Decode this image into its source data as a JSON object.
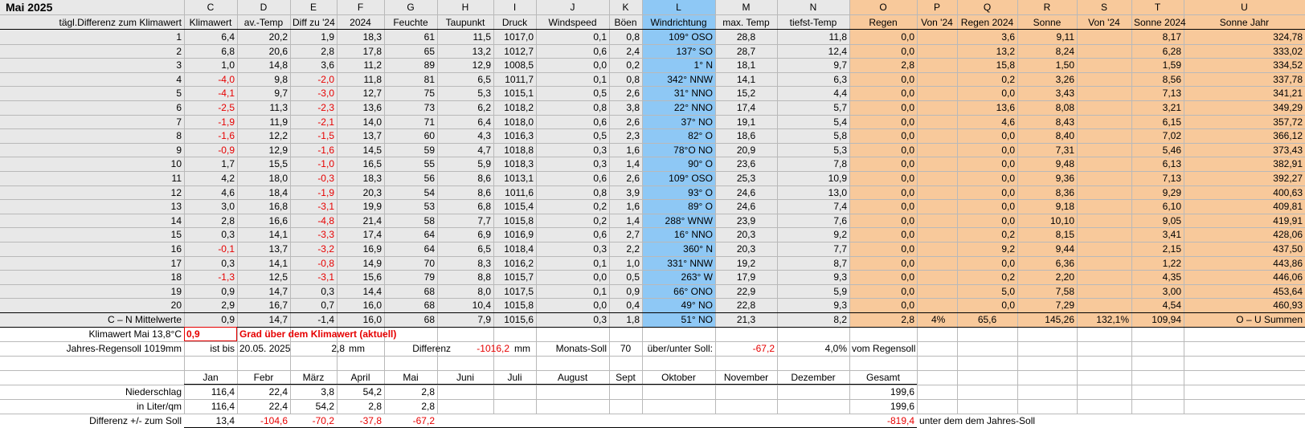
{
  "title": "Mai 2025",
  "subtitle": "tägl.Differenz zum Klimawert",
  "letters": [
    "C",
    "D",
    "E",
    "F",
    "G",
    "H",
    "I",
    "J",
    "K",
    "L",
    "M",
    "N",
    "O",
    "P",
    "Q",
    "R",
    "S",
    "T",
    "U"
  ],
  "headers": [
    "Klimawert",
    "av.-Temp",
    "Diff zu '24",
    "2024",
    "Feuchte",
    "Taupunkt",
    "Druck",
    "Windspeed",
    "Böen",
    "Windrichtung",
    "max. Temp",
    "tiefst-Temp",
    "Regen",
    "Von '24",
    "Regen 2024",
    "Sonne",
    "Von '24",
    "Sonne 2024",
    "Sonne Jahr"
  ],
  "rows": [
    [
      "1",
      "6,4",
      "20,2",
      "1,9",
      "18,3",
      "61",
      "11,5",
      "1017,0",
      "0,1",
      "0,8",
      "109° OSO",
      "28,8",
      "11,8",
      "0,0",
      "",
      "3,6",
      "9,11",
      "",
      "8,17",
      "324,78"
    ],
    [
      "2",
      "6,8",
      "20,6",
      "2,8",
      "17,8",
      "65",
      "13,2",
      "1012,7",
      "0,6",
      "2,4",
      "137° SO",
      "28,7",
      "12,4",
      "0,0",
      "",
      "13,2",
      "8,24",
      "",
      "6,28",
      "333,02"
    ],
    [
      "3",
      "1,0",
      "14,8",
      "3,6",
      "11,2",
      "89",
      "12,9",
      "1008,5",
      "0,0",
      "0,2",
      "1° N",
      "18,1",
      "9,7",
      "2,8",
      "",
      "15,8",
      "1,50",
      "",
      "1,59",
      "334,52"
    ],
    [
      "4",
      "-4,0",
      "9,8",
      "-2,0",
      "11,8",
      "81",
      "6,5",
      "1011,7",
      "0,1",
      "0,8",
      "342° NNW",
      "14,1",
      "6,3",
      "0,0",
      "",
      "0,2",
      "3,26",
      "",
      "8,56",
      "337,78"
    ],
    [
      "5",
      "-4,1",
      "9,7",
      "-3,0",
      "12,7",
      "75",
      "5,3",
      "1015,1",
      "0,5",
      "2,6",
      "31° NNO",
      "15,2",
      "4,4",
      "0,0",
      "",
      "0,0",
      "3,43",
      "",
      "7,13",
      "341,21"
    ],
    [
      "6",
      "-2,5",
      "11,3",
      "-2,3",
      "13,6",
      "73",
      "6,2",
      "1018,2",
      "0,8",
      "3,8",
      "22° NNO",
      "17,4",
      "5,7",
      "0,0",
      "",
      "13,6",
      "8,08",
      "",
      "3,21",
      "349,29"
    ],
    [
      "7",
      "-1,9",
      "11,9",
      "-2,1",
      "14,0",
      "71",
      "6,4",
      "1018,0",
      "0,6",
      "2,6",
      "37° NO",
      "19,1",
      "5,4",
      "0,0",
      "",
      "4,6",
      "8,43",
      "",
      "6,15",
      "357,72"
    ],
    [
      "8",
      "-1,6",
      "12,2",
      "-1,5",
      "13,7",
      "60",
      "4,3",
      "1016,3",
      "0,5",
      "2,3",
      "82° O",
      "18,6",
      "5,8",
      "0,0",
      "",
      "0,0",
      "8,40",
      "",
      "7,02",
      "366,12"
    ],
    [
      "9",
      "-0,9",
      "12,9",
      "-1,6",
      "14,5",
      "59",
      "4,7",
      "1018,8",
      "0,3",
      "1,6",
      "78°O NO",
      "20,9",
      "5,3",
      "0,0",
      "",
      "0,0",
      "7,31",
      "",
      "5,46",
      "373,43"
    ],
    [
      "10",
      "1,7",
      "15,5",
      "-1,0",
      "16,5",
      "55",
      "5,9",
      "1018,3",
      "0,3",
      "1,4",
      "90° O",
      "23,6",
      "7,8",
      "0,0",
      "",
      "0,0",
      "9,48",
      "",
      "6,13",
      "382,91"
    ],
    [
      "11",
      "4,2",
      "18,0",
      "-0,3",
      "18,3",
      "56",
      "8,6",
      "1013,1",
      "0,6",
      "2,6",
      "109° OSO",
      "25,3",
      "10,9",
      "0,0",
      "",
      "0,0",
      "9,36",
      "",
      "7,13",
      "392,27"
    ],
    [
      "12",
      "4,6",
      "18,4",
      "-1,9",
      "20,3",
      "54",
      "8,6",
      "1011,6",
      "0,8",
      "3,9",
      "93° O",
      "24,6",
      "13,0",
      "0,0",
      "",
      "0,0",
      "8,36",
      "",
      "9,29",
      "400,63"
    ],
    [
      "13",
      "3,0",
      "16,8",
      "-3,1",
      "19,9",
      "53",
      "6,8",
      "1015,4",
      "0,2",
      "1,6",
      "89° O",
      "24,6",
      "7,4",
      "0,0",
      "",
      "0,0",
      "9,18",
      "",
      "6,10",
      "409,81"
    ],
    [
      "14",
      "2,8",
      "16,6",
      "-4,8",
      "21,4",
      "58",
      "7,7",
      "1015,8",
      "0,2",
      "1,4",
      "288° WNW",
      "23,9",
      "7,6",
      "0,0",
      "",
      "0,0",
      "10,10",
      "",
      "9,05",
      "419,91"
    ],
    [
      "15",
      "0,3",
      "14,1",
      "-3,3",
      "17,4",
      "64",
      "6,9",
      "1016,9",
      "0,6",
      "2,7",
      "16° NNO",
      "20,3",
      "9,2",
      "0,0",
      "",
      "0,2",
      "8,15",
      "",
      "3,41",
      "428,06"
    ],
    [
      "16",
      "-0,1",
      "13,7",
      "-3,2",
      "16,9",
      "64",
      "6,5",
      "1018,4",
      "0,3",
      "2,2",
      "360° N",
      "20,3",
      "7,7",
      "0,0",
      "",
      "9,2",
      "9,44",
      "",
      "2,15",
      "437,50"
    ],
    [
      "17",
      "0,3",
      "14,1",
      "-0,8",
      "14,9",
      "70",
      "8,3",
      "1016,2",
      "0,1",
      "1,0",
      "331° NNW",
      "19,2",
      "8,7",
      "0,0",
      "",
      "0,0",
      "6,36",
      "",
      "1,22",
      "443,86"
    ],
    [
      "18",
      "-1,3",
      "12,5",
      "-3,1",
      "15,6",
      "79",
      "8,8",
      "1015,7",
      "0,0",
      "0,5",
      "263° W",
      "17,9",
      "9,3",
      "0,0",
      "",
      "0,2",
      "2,20",
      "",
      "4,35",
      "446,06"
    ],
    [
      "19",
      "0,9",
      "14,7",
      "0,3",
      "14,4",
      "68",
      "8,0",
      "1017,5",
      "0,1",
      "0,9",
      "66° ONO",
      "22,9",
      "5,9",
      "0,0",
      "",
      "5,0",
      "7,58",
      "",
      "3,00",
      "453,64"
    ],
    [
      "20",
      "2,9",
      "16,7",
      "0,7",
      "16,0",
      "68",
      "10,4",
      "1015,8",
      "0,0",
      "0,4",
      "49° NO",
      "22,8",
      "9,3",
      "0,0",
      "",
      "0,0",
      "7,29",
      "",
      "4,54",
      "460,93"
    ]
  ],
  "summary": [
    "C – N Mittelwerte",
    "0,9",
    "14,7",
    "-1,4",
    "16,0",
    "68",
    "7,9",
    "1015,6",
    "0,3",
    "1,8",
    "51° NO",
    "21,3",
    "8,2",
    "2,8",
    "4%",
    "65,6",
    "145,26",
    "132,1%",
    "109,94",
    "O – U Summen"
  ],
  "klima": {
    "label": "Klimawert Mai 13,8°C",
    "value": "0,9",
    "text": "Grad über dem Klimawert (aktuell)"
  },
  "jahres": {
    "label": "Jahres-Regensoll 1019mm",
    "ist": "ist bis",
    "date": "20.05. 2025",
    "val": "2,8",
    "mm": "mm",
    "diff_label": "Differenz",
    "diff": "-1016,2",
    "mm2": "mm",
    "monat_label": "Monats-Soll",
    "monat": "70",
    "ueber_label": "über/unter Soll:",
    "ueber": "-67,2",
    "pct": "4,0%",
    "vom": "vom Regensoll"
  },
  "months": [
    "Jan",
    "Febr",
    "März",
    "April",
    "Mai",
    "Juni",
    "Juli",
    "August",
    "Sept",
    "Oktober",
    "November",
    "Dezember",
    "Gesamt"
  ],
  "niederschlag": {
    "label": "Niederschlag",
    "values": [
      "116,4",
      "22,4",
      "3,8",
      "54,2",
      "2,8",
      "",
      "",
      "",
      "",
      "",
      "",
      "",
      "199,6"
    ]
  },
  "liter": {
    "label": "in Liter/qm",
    "values": [
      "116,4",
      "22,4",
      "54,2",
      "2,8",
      "2,8",
      "",
      "",
      "",
      "",
      "",
      "",
      "",
      "199,6"
    ]
  },
  "differenz": {
    "label": "Differenz  +/- zum Soll",
    "values": [
      "13,4",
      "-104,6",
      "-70,2",
      "-37,8",
      "-67,2",
      "",
      "",
      "",
      "",
      "",
      "",
      "",
      "-819,4"
    ],
    "note": "unter dem dem Jahres-Soll"
  },
  "colors": {
    "windrichtung": "#8ec8f5",
    "orange": "#f8c99b",
    "red": "#e60000"
  }
}
